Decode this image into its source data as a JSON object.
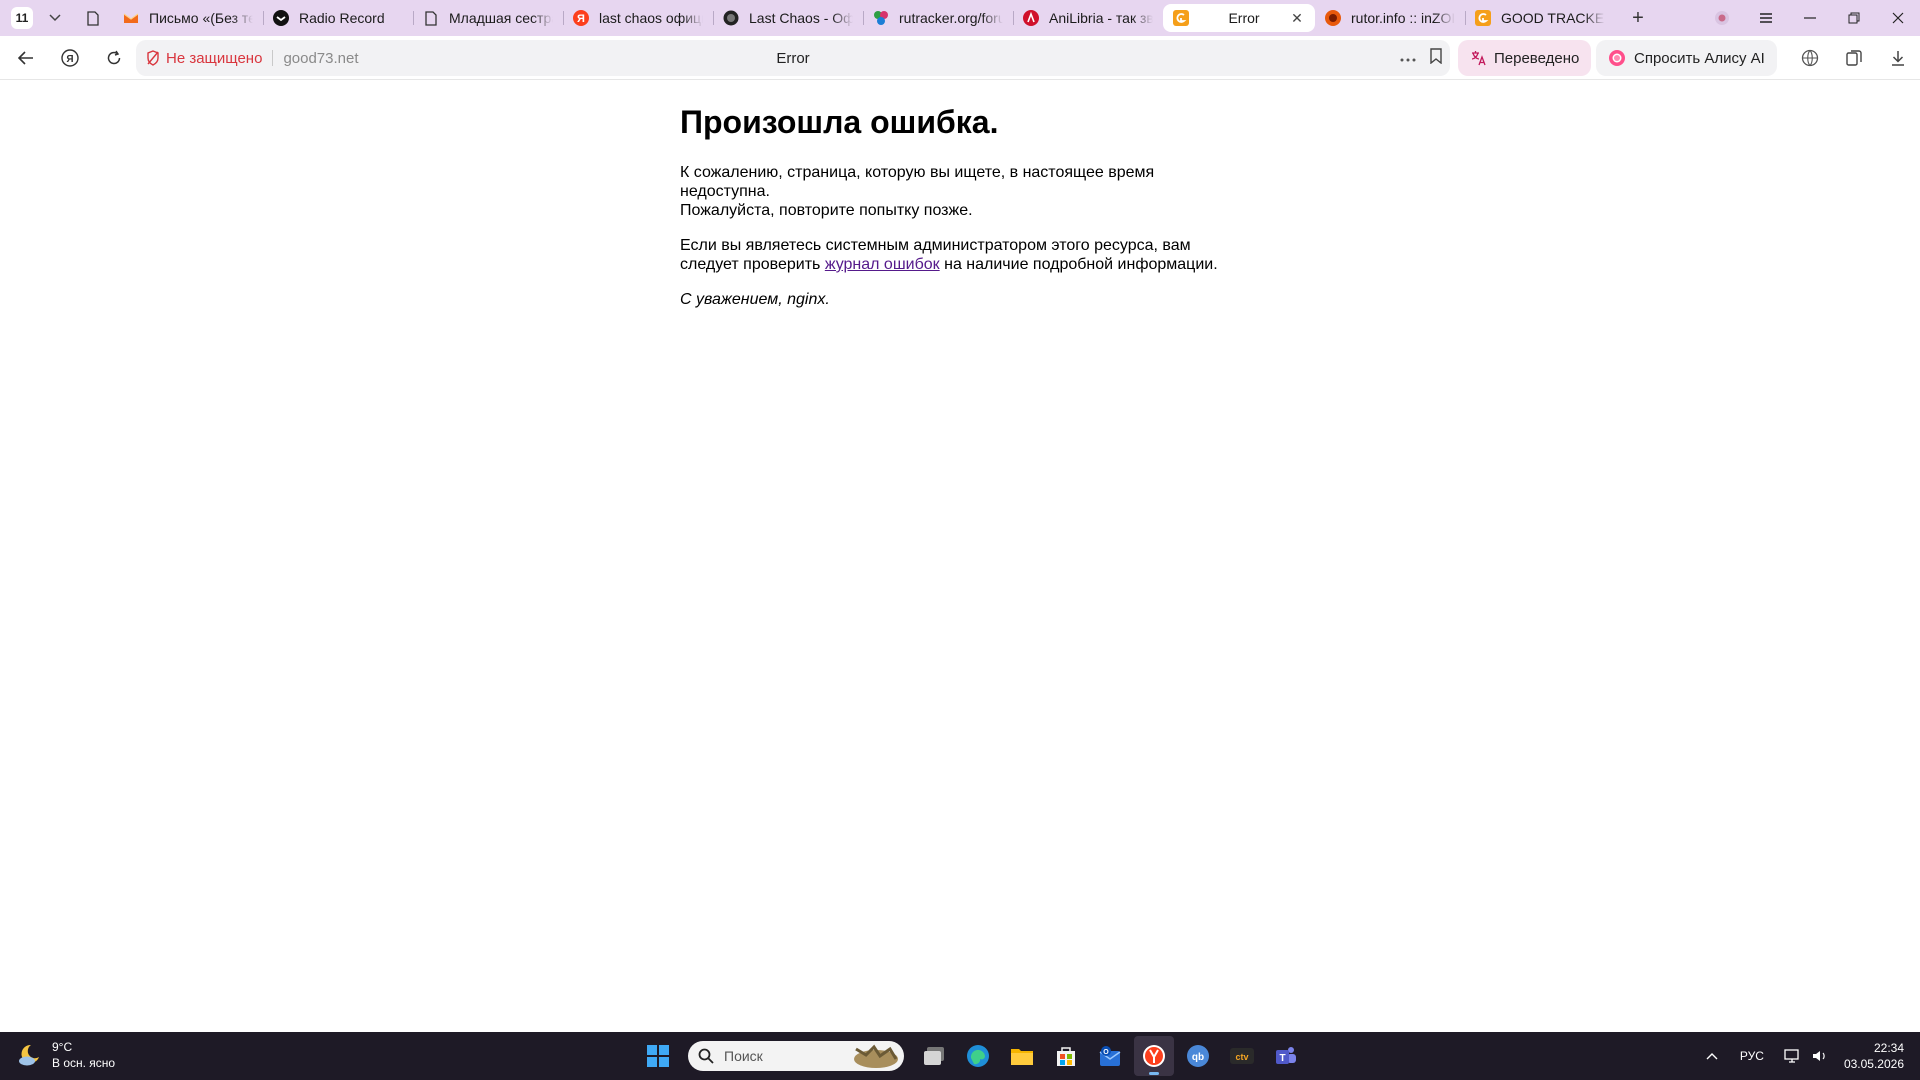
{
  "browser": {
    "tab_count": "11",
    "tabs": [
      {
        "title": "Письмо «(Без темы)»",
        "icon": "mail-icon"
      },
      {
        "title": "Radio Record",
        "icon": "radio-record-icon"
      },
      {
        "title": "Младшая сестра",
        "icon": "document-icon"
      },
      {
        "title": "last chaos официальный",
        "icon": "yandex-icon"
      },
      {
        "title": "Last Chaos - Официальный",
        "icon": "last-chaos-icon"
      },
      {
        "title": "rutracker.org/forum",
        "icon": "rutracker-icon"
      },
      {
        "title": "AniLibria - так звучит",
        "icon": "anilibria-icon"
      },
      {
        "title": "Error",
        "icon": "good-tracker-icon",
        "active": true
      },
      {
        "title": "rutor.info :: inZOI",
        "icon": "rutor-icon"
      },
      {
        "title": "GOOD TRACKER",
        "icon": "good-tracker-icon"
      }
    ],
    "address": {
      "security_label": "Не защищено",
      "url": "good73.net",
      "page_title": "Error"
    },
    "translate_label": "Переведено",
    "alice_label": "Спросить Алису AI"
  },
  "page": {
    "heading": "Произошла ошибка.",
    "p1_line1": "К сожалению, страница, которую вы ищете, в настоящее время недоступна.",
    "p1_line2": "Пожалуйста, повторите попытку позже.",
    "p2_before": "Если вы являетесь системным администратором этого ресурса, вам следует проверить ",
    "p2_link": "журнал ошибок",
    "p2_after": " на наличие подробной информации.",
    "signature": "С уважением, nginx."
  },
  "taskbar": {
    "weather_temp": "9°C",
    "weather_desc": "В осн. ясно",
    "search_placeholder": "Поиск",
    "language": "РУС",
    "time": "22:34",
    "date": "03.05.2026"
  },
  "colors": {
    "tabbar_bg": "#e7d6f0",
    "link": "#551a8b",
    "insecure": "#d9363e",
    "taskbar_bg": "#1e1a26"
  }
}
